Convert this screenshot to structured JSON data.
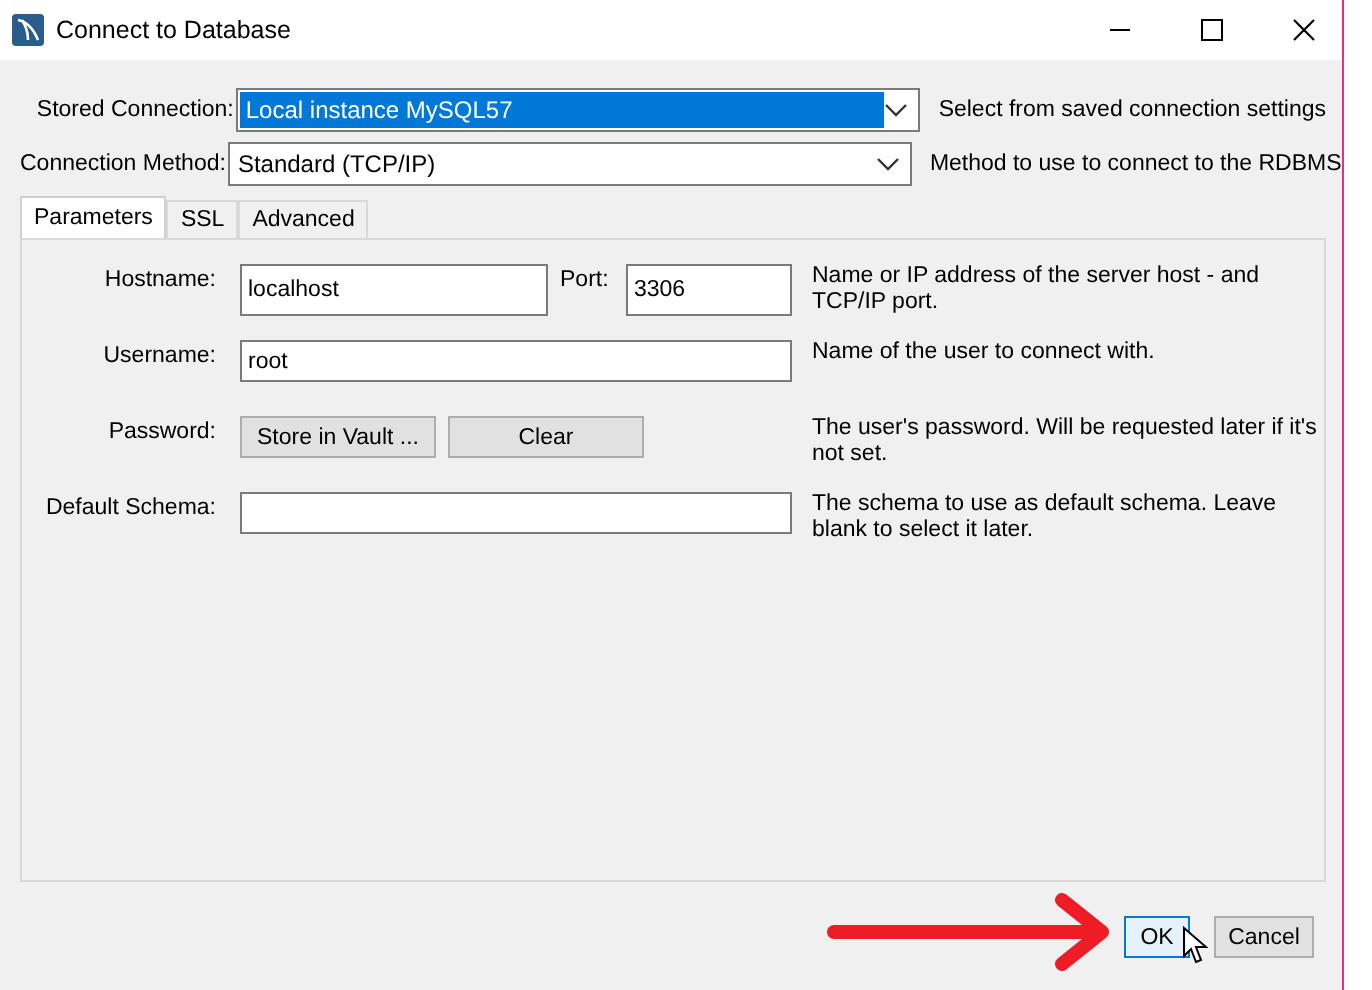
{
  "window": {
    "title": "Connect to Database"
  },
  "stored_connection": {
    "label": "Stored Connection:",
    "value": "Local instance MySQL57",
    "selected": true,
    "hint": "Select from saved connection settings"
  },
  "connection_method": {
    "label": "Connection Method:",
    "value": "Standard (TCP/IP)",
    "selected": false,
    "hint": "Method to use to connect to the RDBMS"
  },
  "tabs": [
    {
      "label": "Parameters",
      "selected": true
    },
    {
      "label": "SSL",
      "selected": false
    },
    {
      "label": "Advanced",
      "selected": false
    }
  ],
  "parameters": [
    {
      "kind": "host",
      "label": "Hostname:",
      "value": "localhost",
      "port_label": "Port:",
      "port_value": "3306",
      "description": "Name or IP address of the server host - and TCP/IP port."
    },
    {
      "kind": "text",
      "label": "Username:",
      "value": "root",
      "description": "Name of the user to connect with."
    },
    {
      "kind": "password",
      "label": "Password:",
      "buttons": [
        "Store in Vault ...",
        "Clear"
      ],
      "description": "The user's password. Will be requested later if it's not set."
    },
    {
      "kind": "text",
      "label": "Default Schema:",
      "description": "The schema to use as default schema. Leave blank to select it later."
    }
  ],
  "buttons": [
    {
      "label": "OK",
      "default": true
    },
    {
      "label": "Cancel",
      "default": false
    }
  ]
}
